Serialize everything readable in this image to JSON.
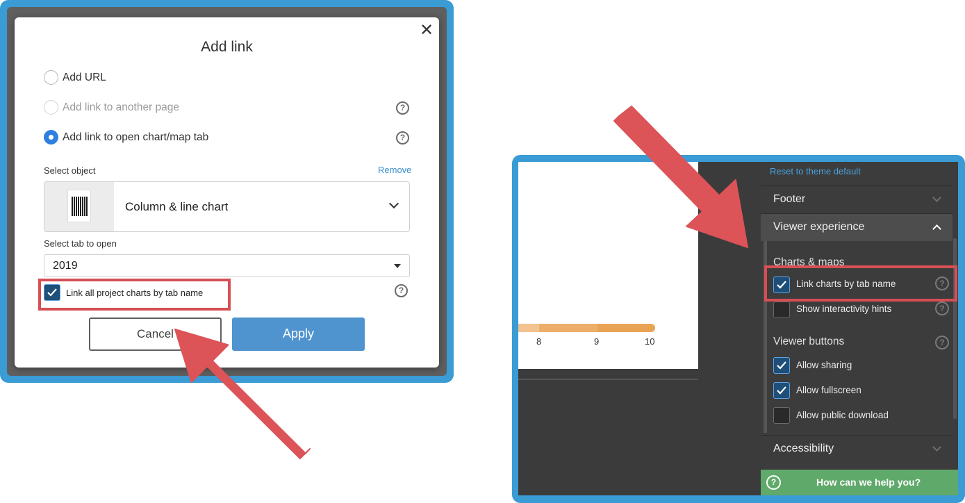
{
  "add_link_dialog": {
    "title": "Add link",
    "close_label": "✕",
    "options": [
      {
        "label": "Add URL",
        "state": "unselected"
      },
      {
        "label": "Add link to another page",
        "state": "disabled"
      },
      {
        "label": "Add link to open chart/map tab",
        "state": "selected"
      }
    ],
    "select_object_label": "Select object",
    "remove_label": "Remove",
    "selected_object": "Column & line chart",
    "select_tab_label": "Select tab to open",
    "selected_tab": "2019",
    "link_all_checkbox": {
      "label": "Link all project charts by tab name",
      "checked": true
    },
    "cancel_label": "Cancel",
    "apply_label": "Apply",
    "help_glyph": "?"
  },
  "canvas": {
    "tick_labels": [
      "8",
      "9",
      "10"
    ]
  },
  "settings_panel": {
    "reset_label": "Reset to theme default",
    "sections": {
      "footer": "Footer",
      "viewer_experience": "Viewer experience",
      "accessibility": "Accessibility"
    },
    "charts_maps_heading": "Charts & maps",
    "link_charts_by_tab_name": {
      "label": "Link charts by tab name",
      "checked": true
    },
    "show_interactivity_hints": {
      "label": "Show interactivity hints",
      "checked": false
    },
    "viewer_buttons_heading": "Viewer buttons",
    "allow_sharing": {
      "label": "Allow sharing",
      "checked": true
    },
    "allow_fullscreen": {
      "label": "Allow fullscreen",
      "checked": true
    },
    "allow_public_download": {
      "label": "Allow public download",
      "checked": false
    },
    "help_button_label": "How can we help you?"
  },
  "colors": {
    "frame": "#3a9bd5",
    "highlight": "#d64f55",
    "arrow": "#dc5358",
    "apply_button": "#4f94cf",
    "radio_selected": "#2f7fe0",
    "help_bar": "#5fa96a"
  }
}
